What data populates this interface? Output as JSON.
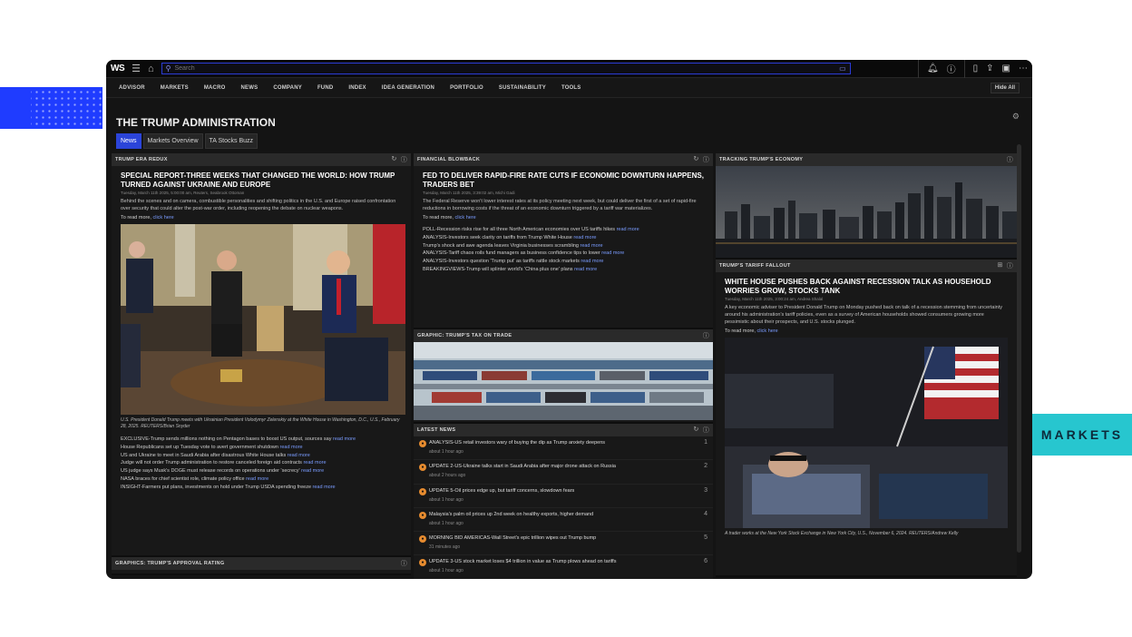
{
  "decor": {
    "markets_tag": "MARKETS"
  },
  "topbar": {
    "logo": "WS",
    "search_placeholder": "Search"
  },
  "nav": {
    "items": [
      "ADVISOR",
      "MARKETS",
      "MACRO",
      "NEWS",
      "COMPANY",
      "FUND",
      "INDEX",
      "IDEA GENERATION",
      "PORTFOLIO",
      "SUSTAINABILITY",
      "TOOLS"
    ],
    "hide_label": "Hide All"
  },
  "page": {
    "title": "THE TRUMP ADMINISTRATION",
    "tabs": [
      "News",
      "Markets Overview",
      "TA Stocks Buzz"
    ],
    "active_tab": 0
  },
  "panels": {
    "era_redux": {
      "header": "TRUMP ERA REDUX",
      "headline": "SPECIAL REPORT-THREE WEEKS THAT CHANGED THE WORLD: HOW TRUMP TURNED AGAINST UKRAINE AND EUROPE",
      "meta": "Tuesday, March 11th 2025, 5:00:00 am, Reuters, Seabrook Ottoman",
      "body": "Behind the scenes and on camera, combustible personalities and shifting politics in the U.S. and Europe raised confrontation over security that could alter the post-war order, including reopening the debate on nuclear weapons.",
      "read_more": "To read more,",
      "click_here": "click here",
      "caption": "U.S. President Donald Trump meets with Ukrainian President Volodymyr Zelenskiy at the White House in Washington, D.C., U.S., February 28, 2025. REUTERS/Brian Snyder",
      "bullets": [
        {
          "text": "EXCLUSIVE-Trump sends millions nothing on Pentagon bases to boost US output, sources say",
          "link": "read more"
        },
        {
          "text": "House Republicans set up Tuesday vote to avert government shutdown",
          "link": "read more"
        },
        {
          "text": "US and Ukraine to meet in Saudi Arabia after disastrous White House talks",
          "link": "read more"
        },
        {
          "text": "Judge will not order Trump administration to restore canceled foreign aid contracts",
          "link": "read more"
        },
        {
          "text": "US judge says Musk's DOGE must release records on operations under 'secrecy'",
          "link": "read more"
        },
        {
          "text": "NASA braces for chief scientist role, climate policy office",
          "link": "read more"
        },
        {
          "text": "INSIGHT-Farmers put plans, investments on hold under Trump USDA spending freeze",
          "link": "read more"
        }
      ]
    },
    "approval": {
      "header": "GRAPHICS: TRUMP'S APPROVAL RATING"
    },
    "blowback": {
      "header": "FINANCIAL BLOWBACK",
      "headline": "FED TO DELIVER RAPID-FIRE RATE CUTS IF ECONOMIC DOWNTURN HAPPENS, TRADERS BET",
      "meta": "Tuesday, March 11th 2025, 3:39:02 am, Michi Gadi",
      "body": "The Federal Reserve won't lower interest rates at its policy meeting next week, but could deliver the first of a set of rapid-fire reductions in borrowing costs if the threat of an economic downturn triggered by a tariff war materializes.",
      "read_more": "To read more,",
      "click_here": "click here",
      "bullets": [
        {
          "text": "POLL-Recession risks rise for all three North American economies over US tariffs hikes",
          "link": "read more"
        },
        {
          "text": "ANALYSIS-Investors seek clarity on tariffs from Trump White House",
          "link": "read more"
        },
        {
          "text": "Trump's shock and awe agenda leaves Virginia businesses scrambling",
          "link": "read more"
        },
        {
          "text": "ANALYSIS-Tariff chaos roils fund managers as business confidence tips to lower",
          "link": "read more"
        },
        {
          "text": "ANALYSIS-Investors question 'Trump put' as tariffs rattle stock markets",
          "link": "read more"
        },
        {
          "text": "BREAKINGVIEWS-Trump will splinter world's 'China plus one' plans",
          "link": "read more"
        }
      ]
    },
    "tax_trade": {
      "header": "GRAPHIC: TRUMP'S TAX ON TRADE"
    },
    "latest_news": {
      "header": "LATEST NEWS",
      "items": [
        {
          "title": "ANALYSIS-US retail investors wary of buying the dip as Trump anxiety deepens",
          "source": "ANALYSIS-US",
          "age": "about 1 hour ago",
          "num": "1"
        },
        {
          "title": "UPDATE 2-US-Ukraine talks start in Saudi Arabia after major drone attack on Russia",
          "source": "UPDATE",
          "age": "about 2 hours ago",
          "num": "2"
        },
        {
          "title": "UPDATE 5-Oil prices edge up, but tariff concerns, slowdown fears",
          "source": "UPDATE",
          "age": "about 1 hour ago",
          "num": "3"
        },
        {
          "title": "Malaysia's palm oil prices up 2nd week on healthy exports, higher demand",
          "source": "Malaysia",
          "age": "about 1 hour ago",
          "num": "4"
        },
        {
          "title": "MORNING BID AMERICAS-Wall Street's epic trillion wipes out Trump bump",
          "source": "MORNING",
          "age": "31 minutes ago",
          "num": "5"
        },
        {
          "title": "UPDATE 3-US stock market loses $4 trillion in value as Trump plows ahead on tariffs",
          "source": "UPDATE",
          "age": "about 1 hour ago",
          "num": "6"
        }
      ]
    },
    "tracking": {
      "header": "TRACKING TRUMP'S ECONOMY"
    },
    "tariff_fallout": {
      "header": "TRUMP'S TARIFF FALLOUT",
      "headline": "WHITE HOUSE PUSHES BACK AGAINST RECESSION TALK AS HOUSEHOLD WORRIES GROW, STOCKS TANK",
      "meta": "Tuesday, March 11th 2025, 3:00:24 am, Andrea Shalal",
      "body": "A key economic adviser to President Donald Trump on Monday pushed back on talk of a recession stemming from uncertainty around his administration's tariff policies, even as a survey of American households showed consumers growing more pessimistic about their prospects, and U.S. stocks plunged.",
      "read_more": "To read more,",
      "click_here": "click here",
      "caption": "A trader works at the New York Stock Exchange in New York City, U.S., November 6, 2024. REUTERS/Andrew Kelly"
    }
  }
}
